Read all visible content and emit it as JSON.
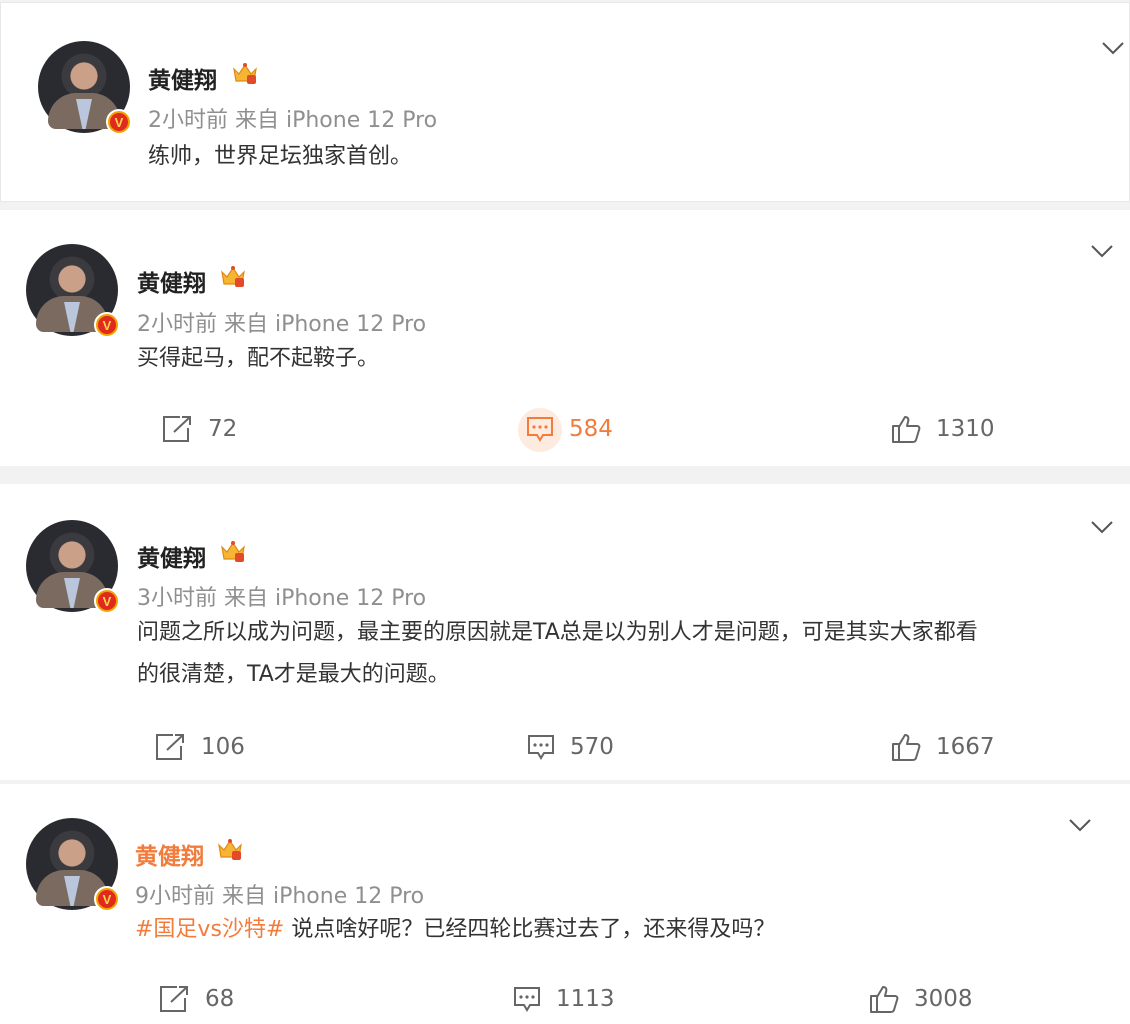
{
  "colors": {
    "accent": "#f17c3b",
    "meta": "#8f8f8f",
    "text": "#333333",
    "divider": "#f2f2f2"
  },
  "posts": [
    {
      "author": "黄健翔",
      "meta": "2小时前  来自 iPhone 12 Pro",
      "content": "练帅，世界足坛独家首创。",
      "menu_icon": "chevron-down-icon"
    },
    {
      "author": "黄健翔",
      "meta": "2小时前  来自 iPhone 12 Pro",
      "content": "买得起马，配不起鞍子。",
      "reposts": "72",
      "comments": "584",
      "likes": "1310",
      "comments_active": true
    },
    {
      "author": "黄健翔",
      "meta": "3小时前  来自 iPhone 12 Pro",
      "content_line1": "问题之所以成为问题，最主要的原因就是TA总是以为别人才是问题，可是其实大家都看",
      "content_line2": "的很清楚，TA才是最大的问题。",
      "reposts": "106",
      "comments": "570",
      "likes": "1667"
    },
    {
      "author": "黄健翔",
      "meta": "9小时前  来自 iPhone 12 Pro",
      "topic": "#国足vs沙特#",
      "content": " 说点啥好呢？已经四轮比赛过去了，还来得及吗？",
      "reposts": "68",
      "comments": "1113",
      "likes": "3008"
    }
  ],
  "icons": {
    "repost": "repost-icon",
    "comment": "comment-icon",
    "like": "thumbs-up-icon",
    "badge": "verified-v-icon",
    "crown": "crown-membership-icon"
  }
}
